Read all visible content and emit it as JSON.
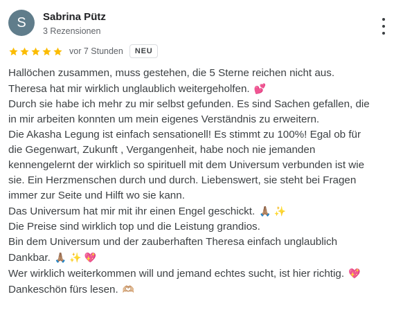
{
  "reviewer": {
    "initial": "S",
    "name": "Sabrina Pütz",
    "review_count": "3 Rezensionen"
  },
  "review": {
    "rating": 5,
    "rating_max": 5,
    "time": "vor 7 Stunden",
    "badge": "NEU",
    "lines": [
      "Hallöchen zusammen, muss gestehen, die 5 Sterne reichen nicht aus.",
      "Theresa hat mir wirklich unglaublich weitergeholfen.",
      "Durch sie habe ich mehr zu mir selbst gefunden. Es sind Sachen gefallen, die",
      "in mir arbeiten konnten um mein eigenes Verständnis zu erweitern.",
      "Die Akasha Legung ist einfach sensationell! Es stimmt zu 100%! Egal ob für",
      "die Gegenwart, Zukunft , Vergangenheit, habe noch nie jemanden",
      "kennengelernt der wirklich so spirituell mit dem Universum verbunden ist wie",
      "sie. Ein Herzmenschen durch und durch. Liebenswert, sie steht bei Fragen",
      "immer zur Seite und Hilft wo sie kann.",
      "Das Universum hat mir mit ihr einen Engel geschickt.",
      "Die Preise sind wirklich top und die Leistung grandios.",
      "Bin dem Universum und der zauberhaften Theresa einfach unglaublich",
      "Dankbar.",
      "Wer wirklich weiterkommen will und jemand echtes sucht, ist hier richtig.",
      "Dankeschön fürs lesen."
    ],
    "emojis": {
      "l1": "💕",
      "l9": "🙏🏽 ✨",
      "l12": "🙏🏽 ✨ 💖",
      "l13": "💖",
      "l14": "🫶🏼"
    }
  },
  "colors": {
    "avatar": "#607d8b",
    "star": "#fbbc04"
  },
  "icons": [
    "star-icon",
    "more-vert-icon"
  ]
}
